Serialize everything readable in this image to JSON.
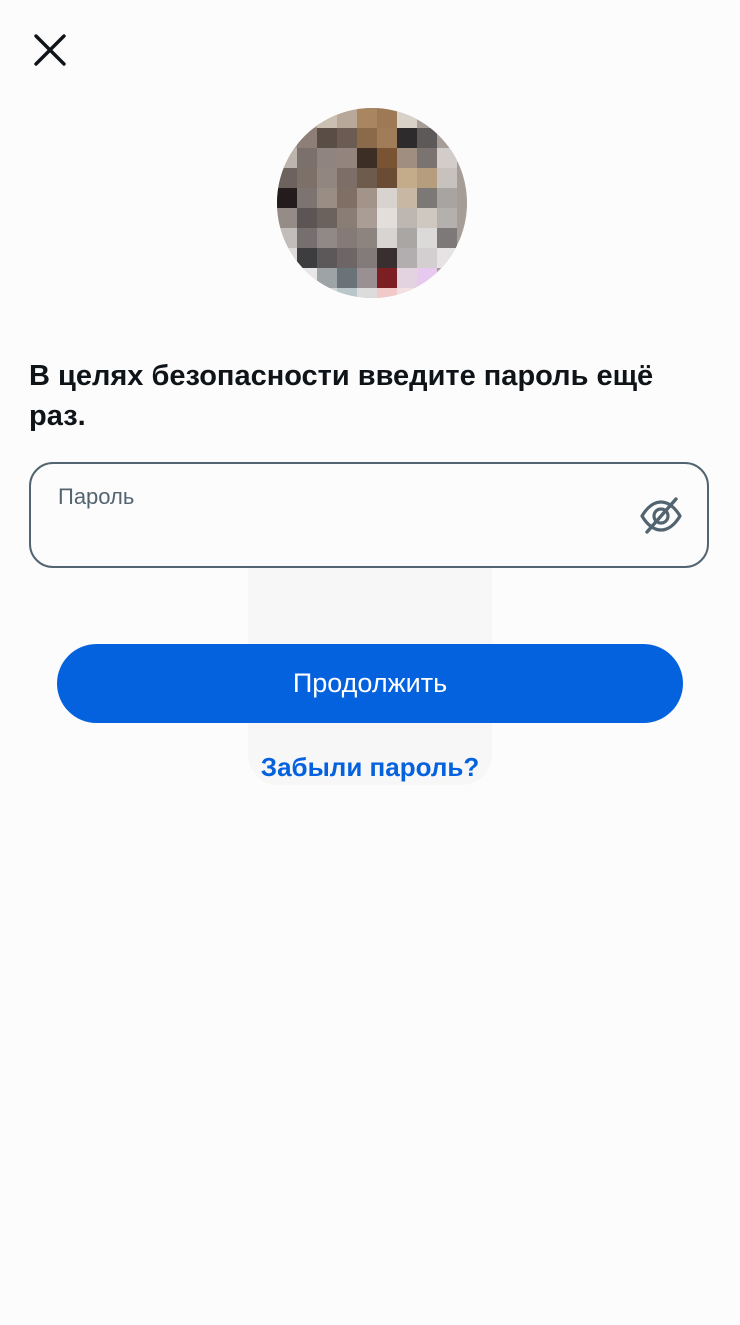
{
  "heading": "В целях безопасности введите пароль ещё раз.",
  "password_field": {
    "label": "Пароль",
    "value": "",
    "visibility": "hidden"
  },
  "continue_button": {
    "label": "Продолжить"
  },
  "forgot_link": {
    "label": "Забыли пароль?"
  },
  "icons": {
    "close": "close-icon",
    "eye_toggle": "eye-off-icon",
    "avatar": "user-avatar"
  },
  "colors": {
    "accent": "#0462de",
    "text_primary": "#0f1419",
    "text_secondary": "#536471",
    "background": "#fcfcfc",
    "field_border": "#536471"
  }
}
